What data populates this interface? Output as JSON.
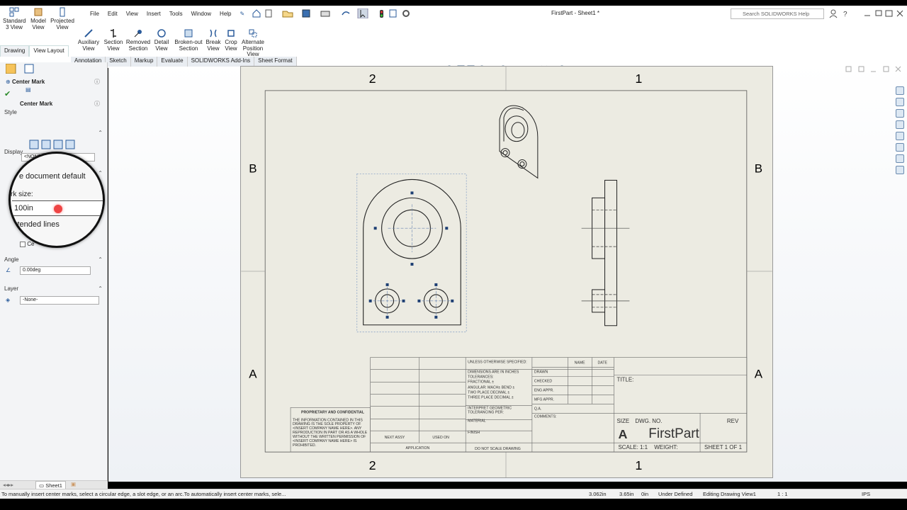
{
  "quick_access": {
    "standard_3_view": "Standard\n3 View",
    "model_view": "Model\nView",
    "projected_view": "Projected\nView"
  },
  "menu": [
    "File",
    "Edit",
    "View",
    "Insert",
    "Tools",
    "Window",
    "Help"
  ],
  "document_title": "FirstPart - Sheet1 *",
  "search_placeholder": "Search SOLIDWORKS Help",
  "command_buttons": [
    {
      "label": "Auxiliary View",
      "icon": "auxiliary-view-icon"
    },
    {
      "label": "Section View",
      "icon": "section-view-icon"
    },
    {
      "label": "Removed Section",
      "icon": "removed-section-icon"
    },
    {
      "label": "Detail View",
      "icon": "detail-view-icon"
    },
    {
      "label": "Broken-out Section",
      "icon": "broken-out-section-icon"
    },
    {
      "label": "Break View",
      "icon": "break-view-icon"
    },
    {
      "label": "Crop View",
      "icon": "crop-view-icon"
    },
    {
      "label": "Alternate Position View",
      "icon": "alternate-position-icon"
    }
  ],
  "tabs_top": [
    "Drawing",
    "View Layout"
  ],
  "tabs_bottom": [
    "Annotation",
    "Sketch",
    "Markup",
    "Evaluate",
    "SOLIDWORKS Add-Ins",
    "Sheet Format"
  ],
  "property_manager": {
    "title": "Center Mark",
    "subtitle": "Center Mark",
    "style_label": "Style",
    "display_label": "Display",
    "display_select": "<NONE>",
    "magnifier": {
      "use_default": "e document default",
      "mark_size_label": "rk size:",
      "mark_size_value": "100in",
      "extended_lines": "xtended lines"
    },
    "centerline_label": "Ce",
    "angle_label": "Angle",
    "angle_value": "0.00deg",
    "layer_label": "Layer",
    "layer_value": "-None-"
  },
  "drawing": {
    "zone_top": [
      "2",
      "1"
    ],
    "zone_side": [
      "B",
      "A"
    ],
    "title_block": {
      "unless": "UNLESS OTHERWISE SPECIFIED:",
      "dims": "DIMENSIONS ARE IN INCHES",
      "tolerances": "TOLERANCES:",
      "fractional": "FRACTIONAL ±",
      "angular": "ANGULAR: MACH±   BEND ±",
      "two_place": "TWO PLACE DECIMAL   ±",
      "three_place": "THREE PLACE DECIMAL  ±",
      "interpret": "INTERPRET GEOMETRIC",
      "tolerancing": "TOLERANCING PER:",
      "material": "MATERIAL",
      "finish": "FINISH",
      "next_assy": "NEXT ASSY",
      "used_on": "USED ON",
      "application": "APPLICATION",
      "do_not_scale": "DO NOT SCALE DRAWING",
      "name": "NAME",
      "date": "DATE",
      "drawn": "DRAWN",
      "checked": "CHECKED",
      "eng_appr": "ENG APPR.",
      "mfg_appr": "MFG APPR.",
      "qa": "Q.A.",
      "comments": "COMMENTS:",
      "title": "TITLE:",
      "size": "SIZE",
      "dwg_no": "DWG.  NO.",
      "rev": "REV",
      "size_value": "A",
      "part_name": "FirstPart",
      "scale": "SCALE: 1:1",
      "weight": "WEIGHT:",
      "sheet": "SHEET 1 OF 1",
      "proprietary_head": "PROPRIETARY AND CONFIDENTIAL",
      "proprietary_lines": [
        "THE INFORMATION CONTAINED IN THIS",
        "DRAWING IS THE SOLE PROPERTY OF",
        "<INSERT COMPANY NAME HERE>.  ANY",
        "REPRODUCTION IN PART OR AS A WHOLE",
        "WITHOUT THE WRITTEN PERMISSION OF",
        "<INSERT COMPANY NAME HERE> IS",
        "PROHIBITED."
      ]
    }
  },
  "sheet_tab": "Sheet1",
  "status": {
    "message": "To manually insert center marks, select a circular edge, a slot edge, or an arc.To automatically insert center marks, sele...",
    "x": "3.062in",
    "y": "3.65in",
    "z": "0in",
    "state": "Under Defined",
    "mode": "Editing Drawing View1",
    "scale": "1 : 1",
    "units": "IPS"
  }
}
